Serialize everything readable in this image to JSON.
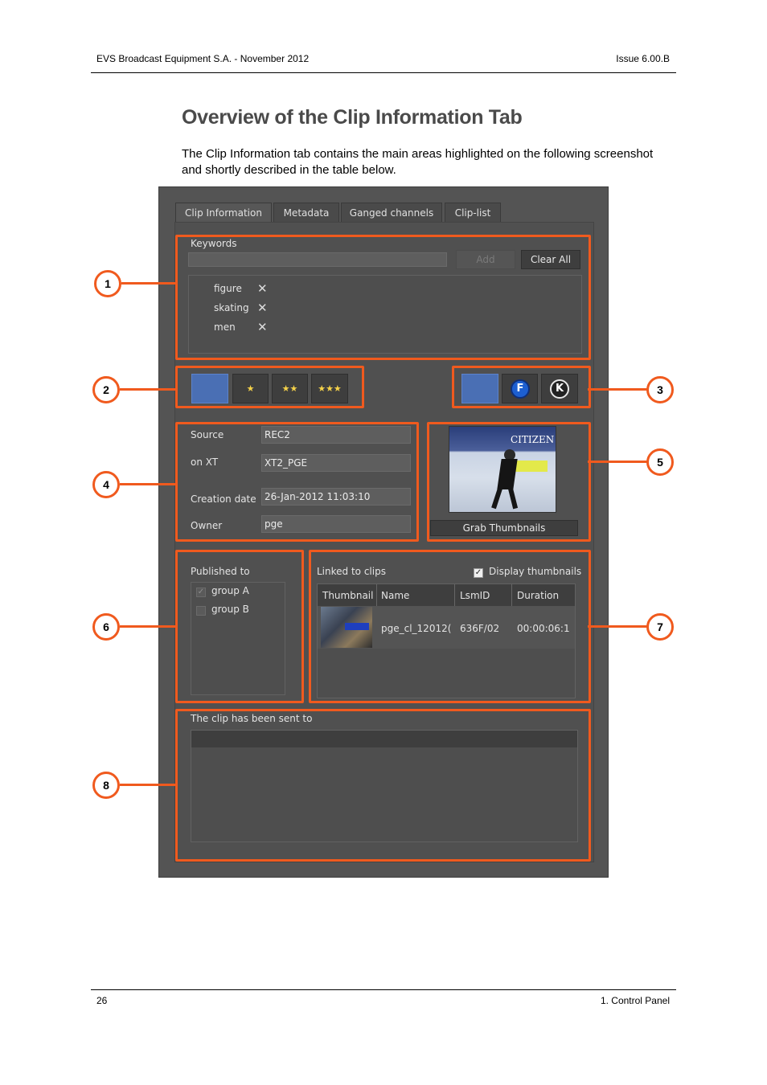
{
  "header": {
    "left": "EVS Broadcast Equipment S.A.  - November 2012",
    "right": "Issue 6.00.B"
  },
  "title": "Overview of the Clip Information Tab",
  "intro": "The Clip Information tab contains the main areas highlighted on the following screenshot and shortly described in the table below.",
  "footer": {
    "page": "26",
    "section": "1. Control Panel"
  },
  "screenshot": {
    "tabs": [
      "Clip Information",
      "Metadata",
      "Ganged channels",
      "Clip-list"
    ],
    "keywords": {
      "label": "Keywords",
      "add_label": "Add",
      "clear_label": "Clear All",
      "items": [
        "figure",
        "skating",
        "men"
      ]
    },
    "rating": {
      "stars": [
        "★",
        "★★",
        "★★★"
      ]
    },
    "flags": {
      "f_label": "F",
      "k_label": "K"
    },
    "source": {
      "source_label": "Source",
      "source_value": "REC2",
      "onxt_label": "on XT",
      "onxt_value": "XT2_PGE",
      "date_label": "Creation date",
      "date_value": "26-Jan-2012 11:03:10",
      "owner_label": "Owner",
      "owner_value": "pge"
    },
    "thumbnail": {
      "logo_text": "CITIZEN",
      "grab_label": "Grab Thumbnails"
    },
    "published": {
      "label": "Published to",
      "groups": [
        "group A",
        "group B"
      ],
      "checked": [
        true,
        false
      ]
    },
    "linked": {
      "label": "Linked to clips",
      "display_thumbs_label": "Display thumbnails",
      "display_thumbs_checked": true,
      "columns": [
        "Thumbnail",
        "Name",
        "LsmID",
        "Duration"
      ],
      "rows": [
        {
          "name": "pge_cl_12012(",
          "lsmid": "636F/02",
          "duration": "00:00:06:1"
        }
      ]
    },
    "sent": {
      "label": "The clip has been sent to"
    }
  },
  "callouts": [
    "1",
    "2",
    "3",
    "4",
    "5",
    "6",
    "7",
    "8"
  ],
  "colors": {
    "highlight": "#f05a1e",
    "ui_bg": "#545454",
    "rating_blue": "#4a6fb4"
  }
}
